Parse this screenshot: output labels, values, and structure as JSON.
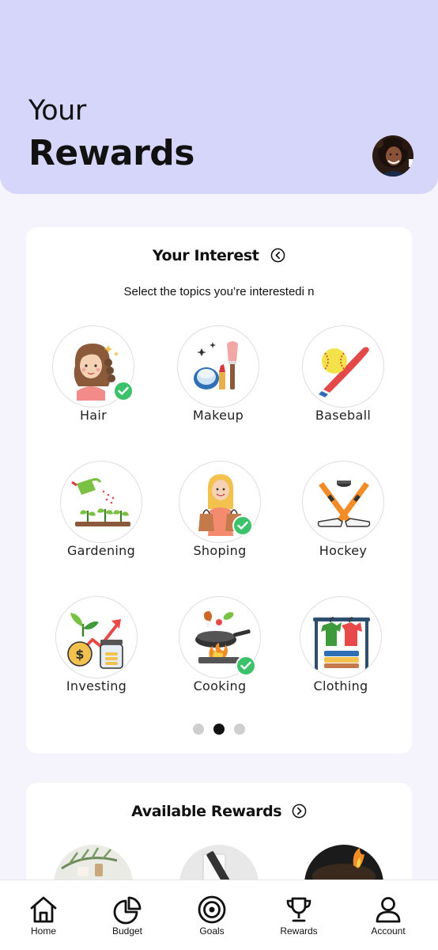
{
  "header": {
    "title_line1": "Your",
    "title_line2": "Rewards"
  },
  "interest": {
    "title": "Your Interest",
    "subtitle": "Select the topics you’re interestedi n",
    "topics": [
      {
        "label": "Hair",
        "icon": "hair-icon",
        "selected": true
      },
      {
        "label": "Makeup",
        "icon": "makeup-icon",
        "selected": false
      },
      {
        "label": "Baseball",
        "icon": "baseball-icon",
        "selected": false
      },
      {
        "label": "Gardening",
        "icon": "gardening-icon",
        "selected": false
      },
      {
        "label": "Shoping",
        "icon": "shopping-icon",
        "selected": true
      },
      {
        "label": "Hockey",
        "icon": "hockey-icon",
        "selected": false
      },
      {
        "label": "Investing",
        "icon": "investing-icon",
        "selected": false
      },
      {
        "label": "Cooking",
        "icon": "cooking-icon",
        "selected": true
      },
      {
        "label": "Clothing",
        "icon": "clothing-icon",
        "selected": false
      }
    ],
    "pagination": {
      "pages": 3,
      "current": 2
    }
  },
  "rewards": {
    "title": "Available Rewards"
  },
  "nav": {
    "items": [
      {
        "label": "Home",
        "icon": "home-icon"
      },
      {
        "label": "Budget",
        "icon": "pie-chart-icon"
      },
      {
        "label": "Goals",
        "icon": "target-icon"
      },
      {
        "label": "Rewards",
        "icon": "trophy-icon"
      },
      {
        "label": "Account",
        "icon": "user-icon"
      }
    ]
  },
  "colors": {
    "header_bg": "#d6d6fb",
    "page_bg": "#f5f4fc",
    "check_green": "#3cc26a",
    "active_dot": "#111111",
    "inactive_dot": "#cfcfcf"
  }
}
